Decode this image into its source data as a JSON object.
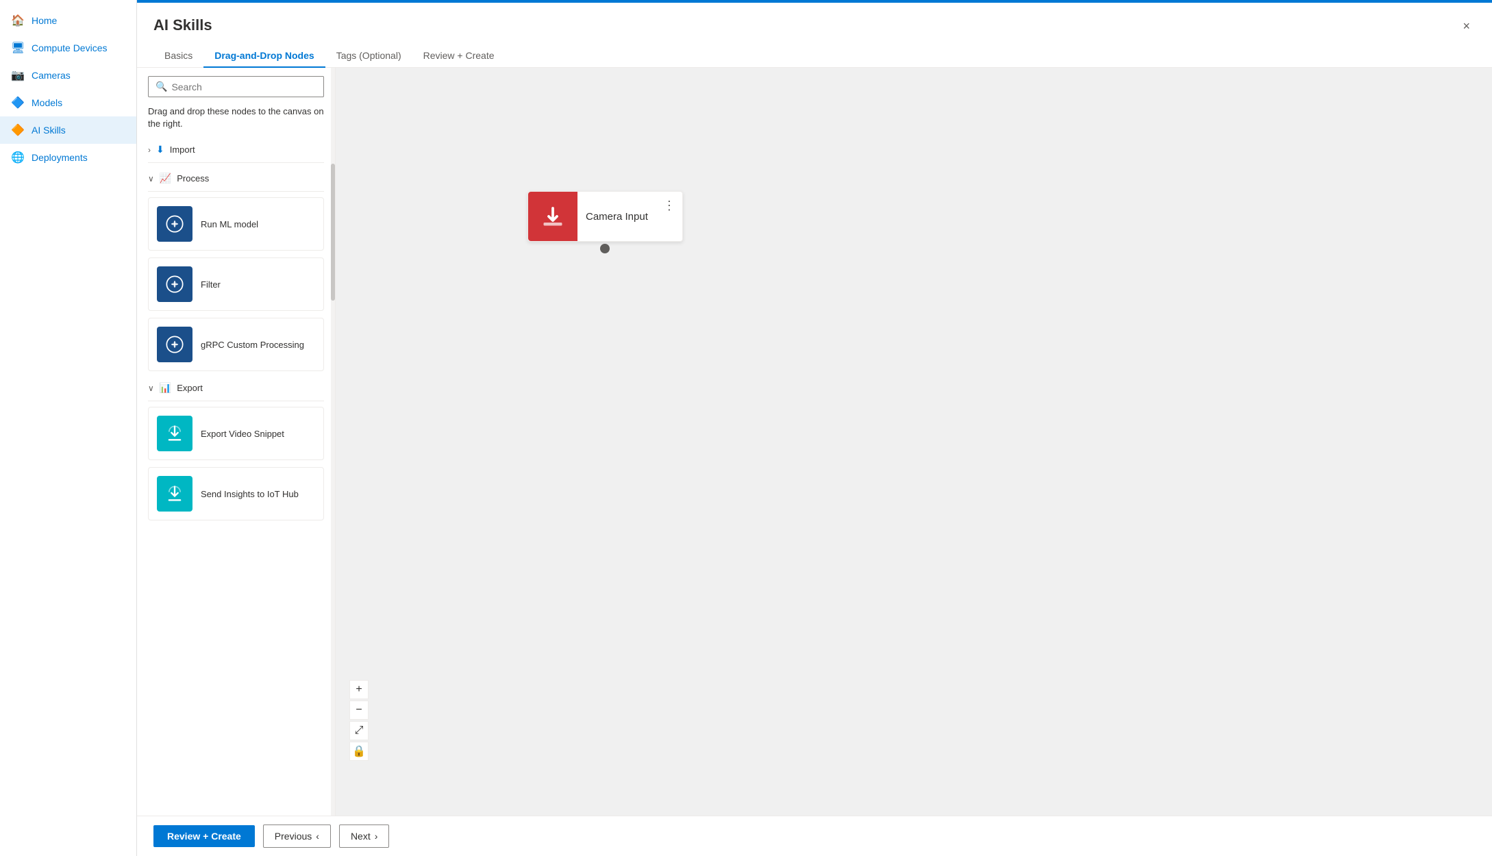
{
  "sidebar": {
    "items": [
      {
        "id": "home",
        "label": "Home",
        "icon": "🏠"
      },
      {
        "id": "compute",
        "label": "Compute Devices",
        "icon": "🖥"
      },
      {
        "id": "cameras",
        "label": "Cameras",
        "icon": "📷"
      },
      {
        "id": "models",
        "label": "Models",
        "icon": "🔷"
      },
      {
        "id": "aiskills",
        "label": "AI Skills",
        "icon": "🔶",
        "active": true
      },
      {
        "id": "deployments",
        "label": "Deployments",
        "icon": "🌐"
      }
    ]
  },
  "header": {
    "title": "AI Skills",
    "close_label": "×"
  },
  "tabs": [
    {
      "id": "basics",
      "label": "Basics",
      "active": false
    },
    {
      "id": "drag-drop",
      "label": "Drag-and-Drop Nodes",
      "active": true
    },
    {
      "id": "tags",
      "label": "Tags (Optional)",
      "active": false
    },
    {
      "id": "review",
      "label": "Review + Create",
      "active": false
    }
  ],
  "panel": {
    "search_placeholder": "Search",
    "description": "Drag and drop these nodes to the canvas on the right.",
    "sections": [
      {
        "id": "import",
        "label": "Import",
        "icon": "↓",
        "expanded": false,
        "nodes": []
      },
      {
        "id": "process",
        "label": "Process",
        "icon": "📈",
        "expanded": true,
        "nodes": [
          {
            "id": "run-ml",
            "label": "Run ML model",
            "icon_type": "dark-blue",
            "icon": "🧠"
          },
          {
            "id": "filter",
            "label": "Filter",
            "icon_type": "dark-blue",
            "icon": "🧠"
          },
          {
            "id": "grpc",
            "label": "gRPC Custom Processing",
            "icon_type": "dark-blue",
            "icon": "🧠"
          }
        ]
      },
      {
        "id": "export",
        "label": "Export",
        "icon": "📊",
        "expanded": true,
        "nodes": [
          {
            "id": "export-video",
            "label": "Export Video Snippet",
            "icon_type": "teal",
            "icon": "☁"
          },
          {
            "id": "send-insights",
            "label": "Send Insights to IoT Hub",
            "icon_type": "teal",
            "icon": "☁"
          }
        ]
      }
    ]
  },
  "canvas": {
    "node": {
      "label": "Camera Input",
      "icon": "↓",
      "menu_dots": "⋮"
    }
  },
  "zoom_controls": [
    {
      "id": "zoom-in",
      "label": "+"
    },
    {
      "id": "zoom-out",
      "label": "−"
    },
    {
      "id": "zoom-fit",
      "label": "⤢"
    },
    {
      "id": "zoom-lock",
      "label": "🔒"
    }
  ],
  "bottom_bar": {
    "review_create": "Review + Create",
    "previous": "Previous",
    "previous_icon": "‹",
    "next": "Next",
    "next_icon": "›"
  }
}
